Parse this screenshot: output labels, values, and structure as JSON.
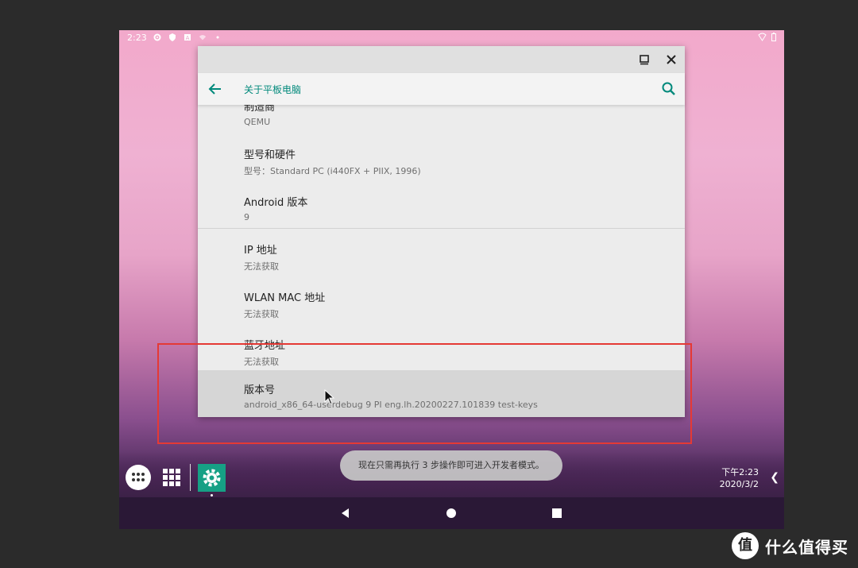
{
  "statusbar": {
    "time": "2:23",
    "icons": [
      "gear-icon",
      "shield-icon",
      "a-icon",
      "wifi-icon",
      "dot-icon"
    ],
    "right_icons": [
      "signal-icon",
      "battery-icon"
    ]
  },
  "window": {
    "titlebar_buttons": [
      "maximize-icon",
      "close-icon"
    ]
  },
  "appbar": {
    "title": "关于平板电脑"
  },
  "items": [
    {
      "title": "制造商",
      "subtitle": "QEMU"
    },
    {
      "title": "型号和硬件",
      "subtitle": "型号：Standard PC (i440FX + PIIX, 1996)"
    },
    {
      "title": "Android 版本",
      "subtitle": "9"
    },
    {
      "title": "IP 地址",
      "subtitle": "无法获取"
    },
    {
      "title": "WLAN MAC 地址",
      "subtitle": "无法获取"
    },
    {
      "title": "蓝牙地址",
      "subtitle": "无法获取"
    },
    {
      "title": "版本号",
      "subtitle": "android_x86_64-userdebug 9 PI eng.lh.20200227.101839 test-keys"
    }
  ],
  "toast": "现在只需再执行 3 步操作即可进入开发者模式。",
  "taskbar": {
    "clock_time": "下午2:23",
    "clock_date": "2020/3/2"
  },
  "watermark": {
    "logo": "值",
    "text": "什么值得买"
  },
  "colors": {
    "accent": "#00897b",
    "highlight_box": "#e53935"
  }
}
